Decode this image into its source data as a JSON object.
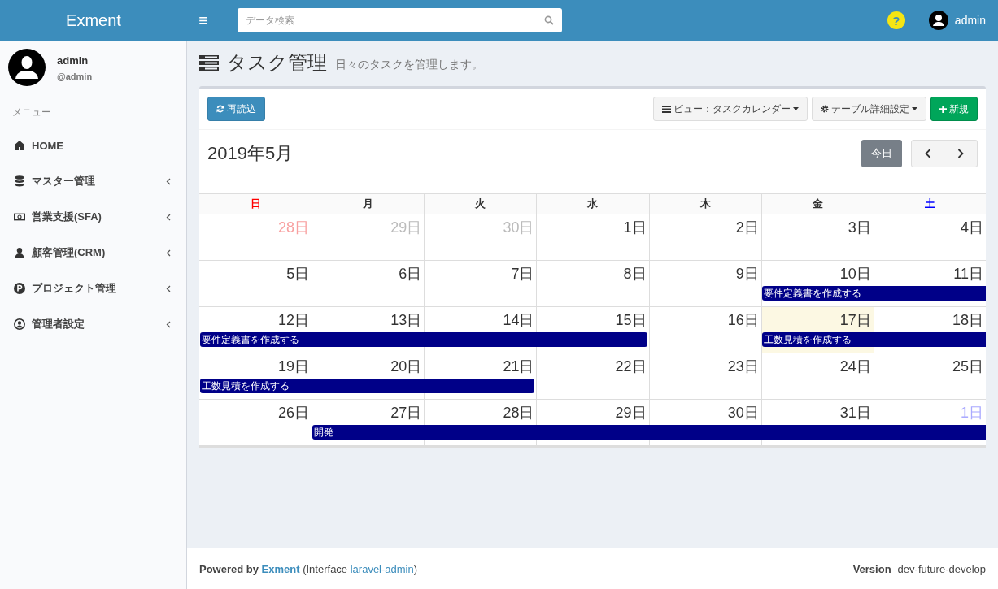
{
  "header": {
    "logo": "Exment",
    "menu_toggle": "≡",
    "search": {
      "placeholder": "データ検索"
    },
    "help": "?",
    "user": "admin"
  },
  "sidebar": {
    "user": {
      "name": "admin",
      "handle": "@admin"
    },
    "menu_label": "メニュー",
    "items": [
      {
        "label": "HOME",
        "expandable": false
      },
      {
        "label": "マスター管理",
        "expandable": true
      },
      {
        "label": "営業支援(SFA)",
        "expandable": true
      },
      {
        "label": "顧客管理(CRM)",
        "expandable": true
      },
      {
        "label": "プロジェクト管理",
        "expandable": true
      },
      {
        "label": "管理者設定",
        "expandable": true
      }
    ]
  },
  "page": {
    "title": "タスク管理",
    "subtitle": "日々のタスクを管理します。"
  },
  "toolbar": {
    "reload": "再読込",
    "view": "ビュー：タスクカレンダー",
    "settings": "テーブル詳細設定",
    "new": "新規"
  },
  "calendar": {
    "title": "2019年5月",
    "today_button": "今日",
    "weekdays": [
      "日",
      "月",
      "火",
      "水",
      "木",
      "金",
      "土"
    ],
    "weeks": [
      {
        "days": [
          {
            "label": "28日",
            "other_month": true,
            "today": false
          },
          {
            "label": "29日",
            "other_month": true,
            "today": false
          },
          {
            "label": "30日",
            "other_month": true,
            "today": false
          },
          {
            "label": "1日",
            "other_month": false,
            "today": false
          },
          {
            "label": "2日",
            "other_month": false,
            "today": false
          },
          {
            "label": "3日",
            "other_month": false,
            "today": false
          },
          {
            "label": "4日",
            "other_month": false,
            "today": false
          }
        ]
      },
      {
        "days": [
          {
            "label": "5日",
            "other_month": false,
            "today": false
          },
          {
            "label": "6日",
            "other_month": false,
            "today": false
          },
          {
            "label": "7日",
            "other_month": false,
            "today": false
          },
          {
            "label": "8日",
            "other_month": false,
            "today": false
          },
          {
            "label": "9日",
            "other_month": false,
            "today": false
          },
          {
            "label": "10日",
            "other_month": false,
            "today": false,
            "event": {
              "starts": true,
              "ends": false,
              "title": "要件定義書を作成する"
            }
          },
          {
            "label": "11日",
            "other_month": false,
            "today": false,
            "event": {
              "starts": false,
              "ends": false
            }
          }
        ]
      },
      {
        "days": [
          {
            "label": "12日",
            "other_month": false,
            "today": false,
            "event": {
              "starts": true,
              "ends": false,
              "title": "要件定義書を作成する"
            }
          },
          {
            "label": "13日",
            "other_month": false,
            "today": false,
            "event": {
              "starts": false,
              "ends": false
            }
          },
          {
            "label": "14日",
            "other_month": false,
            "today": false,
            "event": {
              "starts": false,
              "ends": false
            }
          },
          {
            "label": "15日",
            "other_month": false,
            "today": false,
            "event": {
              "starts": false,
              "ends": true
            }
          },
          {
            "label": "16日",
            "other_month": false,
            "today": false
          },
          {
            "label": "17日",
            "other_month": false,
            "today": true,
            "event": {
              "starts": true,
              "ends": false,
              "title": "工数見積を作成する"
            }
          },
          {
            "label": "18日",
            "other_month": false,
            "today": false,
            "event": {
              "starts": false,
              "ends": false
            }
          }
        ]
      },
      {
        "days": [
          {
            "label": "19日",
            "other_month": false,
            "today": false,
            "event": {
              "starts": true,
              "ends": false,
              "title": "工数見積を作成する"
            }
          },
          {
            "label": "20日",
            "other_month": false,
            "today": false,
            "event": {
              "starts": false,
              "ends": false
            }
          },
          {
            "label": "21日",
            "other_month": false,
            "today": false,
            "event": {
              "starts": false,
              "ends": true
            }
          },
          {
            "label": "22日",
            "other_month": false,
            "today": false
          },
          {
            "label": "23日",
            "other_month": false,
            "today": false
          },
          {
            "label": "24日",
            "other_month": false,
            "today": false
          },
          {
            "label": "25日",
            "other_month": false,
            "today": false
          }
        ]
      },
      {
        "days": [
          {
            "label": "26日",
            "other_month": false,
            "today": false
          },
          {
            "label": "27日",
            "other_month": false,
            "today": false,
            "event": {
              "starts": true,
              "ends": false,
              "title": "開発"
            }
          },
          {
            "label": "28日",
            "other_month": false,
            "today": false,
            "event": {
              "starts": false,
              "ends": false
            }
          },
          {
            "label": "29日",
            "other_month": false,
            "today": false,
            "event": {
              "starts": false,
              "ends": false
            }
          },
          {
            "label": "30日",
            "other_month": false,
            "today": false,
            "event": {
              "starts": false,
              "ends": false
            }
          },
          {
            "label": "31日",
            "other_month": false,
            "today": false,
            "event": {
              "starts": false,
              "ends": false
            }
          },
          {
            "label": "1日",
            "other_month": true,
            "today": false,
            "event": {
              "starts": false,
              "ends": false
            }
          }
        ]
      }
    ]
  },
  "footer": {
    "powered": "Powered by",
    "brand": "Exment",
    "interface_open": "(Interface",
    "interface_link": "laravel-admin",
    "interface_close": ")",
    "version_label": "Version",
    "version": "dev-future-develop"
  }
}
